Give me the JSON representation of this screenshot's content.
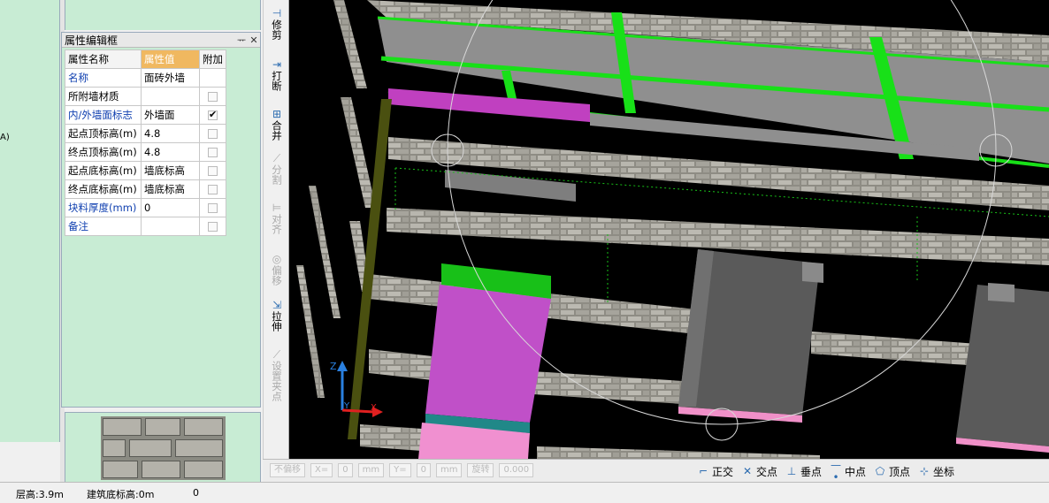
{
  "left_panel": {
    "fragment": "A)"
  },
  "property_editor": {
    "title": "属性编辑框",
    "columns": {
      "name": "属性名称",
      "value": "属性值",
      "extra": "附加"
    },
    "rows": [
      {
        "name": "名称",
        "value": "面砖外墙",
        "checkbox": false,
        "checked": false,
        "blue": true
      },
      {
        "name": "所附墙材质",
        "value": "",
        "checkbox": true,
        "checked": false,
        "blue": false
      },
      {
        "name": "内/外墙面标志",
        "value": "外墙面",
        "checkbox": true,
        "checked": true,
        "blue": true
      },
      {
        "name": "起点顶标高(m)",
        "value": "4.8",
        "checkbox": true,
        "checked": false,
        "blue": false
      },
      {
        "name": "终点顶标高(m)",
        "value": "4.8",
        "checkbox": true,
        "checked": false,
        "blue": false
      },
      {
        "name": "起点底标高(m)",
        "value": "墙底标高",
        "checkbox": true,
        "checked": false,
        "blue": false
      },
      {
        "name": "终点底标高(m)",
        "value": "墙底标高",
        "checkbox": true,
        "checked": false,
        "blue": false
      },
      {
        "name": "块料厚度(mm)",
        "value": "0",
        "checkbox": true,
        "checked": false,
        "blue": true
      },
      {
        "name": "备注",
        "value": "",
        "checkbox": true,
        "checked": false,
        "blue": true
      }
    ],
    "pin_icon": "pin-icon",
    "close_icon": "close-icon"
  },
  "vertical_toolbar": {
    "items": [
      {
        "label": "修剪",
        "icon": "trim-icon",
        "enabled": true
      },
      {
        "label": "打断",
        "icon": "break-icon",
        "enabled": true
      },
      {
        "label": "合并",
        "icon": "merge-icon",
        "enabled": true
      },
      {
        "label": "分割",
        "icon": "split-icon",
        "enabled": false
      },
      {
        "label": "对齐",
        "icon": "align-icon",
        "enabled": false
      },
      {
        "label": "偏移",
        "icon": "offset-icon",
        "enabled": false
      },
      {
        "label": "拉伸",
        "icon": "stretch-icon",
        "enabled": true
      },
      {
        "label": "设置夹点",
        "icon": "grip-icon",
        "enabled": false
      }
    ]
  },
  "viewport": {
    "axis_z": "Z",
    "axis_y": "Y",
    "axis_x": "X"
  },
  "bottom_toolbar": {
    "disabled": [
      "不偏移",
      "X=",
      "0",
      "mm",
      "Y=",
      "0",
      "mm",
      "旋转",
      "0.000"
    ],
    "snaps": [
      {
        "label": "正交",
        "icon": "ortho-icon"
      },
      {
        "label": "交点",
        "icon": "intersection-icon"
      },
      {
        "label": "垂点",
        "icon": "perpendicular-icon"
      },
      {
        "label": "中点",
        "icon": "midpoint-icon"
      },
      {
        "label": "顶点",
        "icon": "vertex-icon"
      },
      {
        "label": "坐标",
        "icon": "coordinate-icon"
      }
    ]
  },
  "status_bar": {
    "floor_height": "层高:3.9m",
    "base_elevation": "建筑底标高:0m",
    "extra": "0"
  }
}
